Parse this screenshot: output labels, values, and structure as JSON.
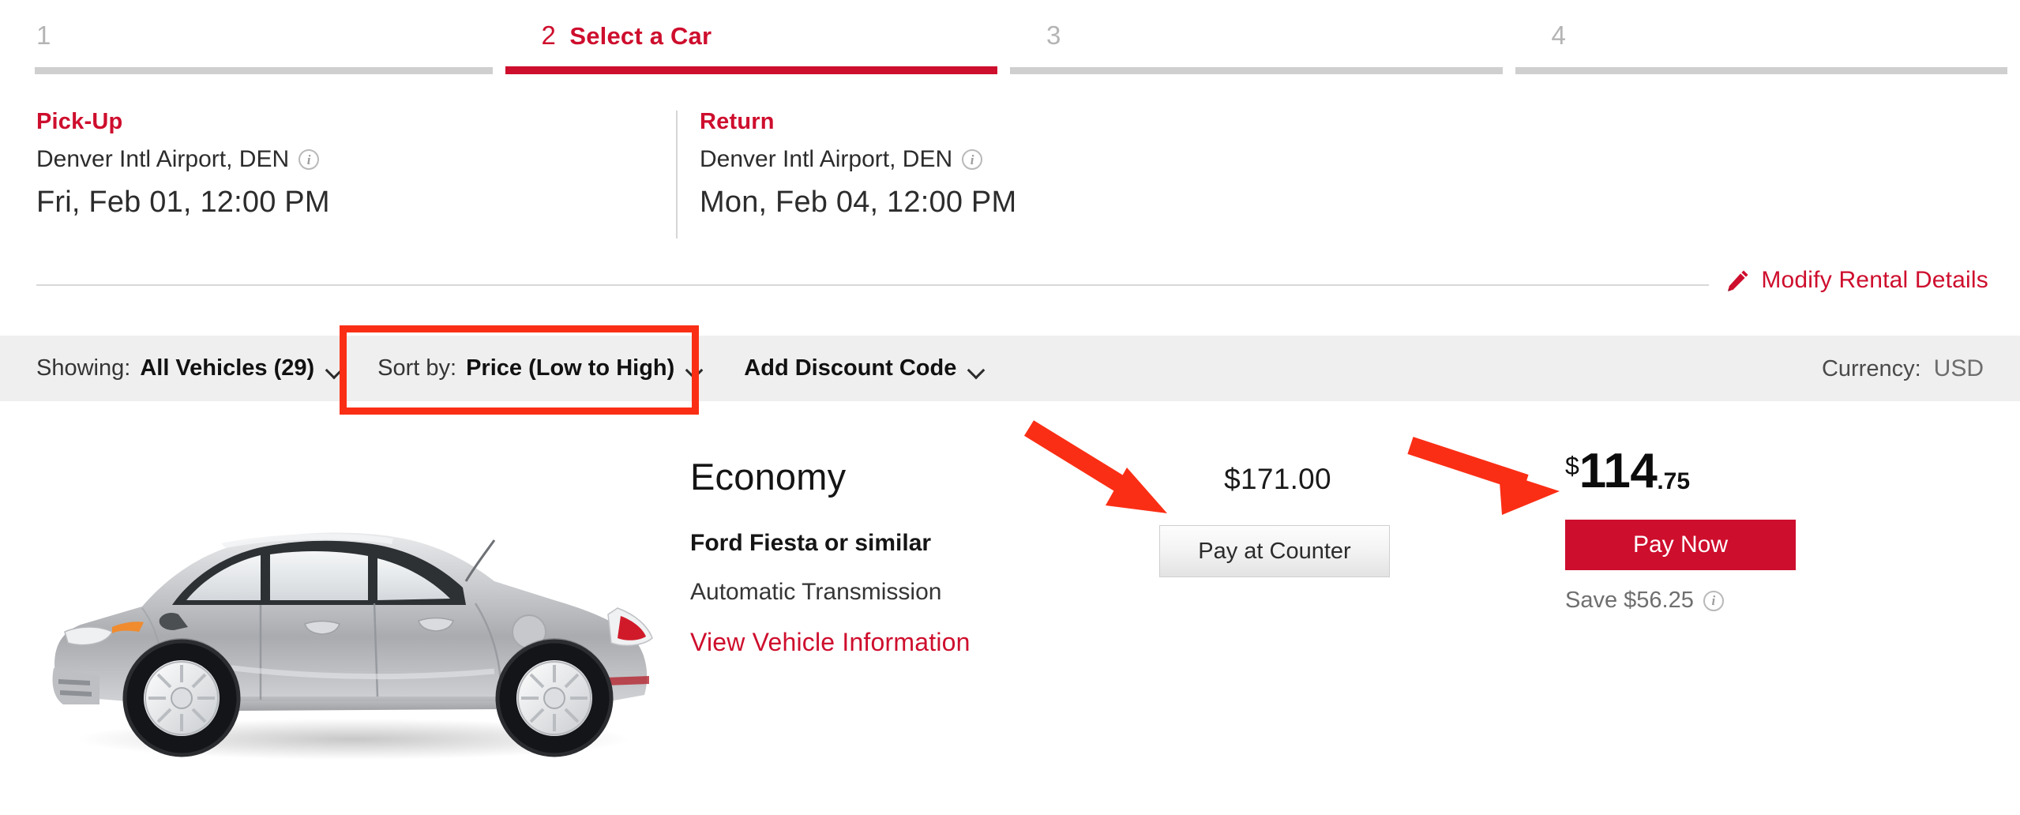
{
  "brand": {
    "red": "#CE0E2D",
    "annotation_red": "#FA2E15",
    "bar_gray": "#CFCFCF",
    "filterbar_gray": "#EFEFEF"
  },
  "steps": [
    {
      "number": "1",
      "label": "",
      "active": false
    },
    {
      "number": "2",
      "label": "Select a Car",
      "active": true
    },
    {
      "number": "3",
      "label": "",
      "active": false
    },
    {
      "number": "4",
      "label": "",
      "active": false
    }
  ],
  "summary": {
    "pickup": {
      "title": "Pick-Up",
      "location": "Denver Intl Airport, DEN",
      "datetime": "Fri, Feb 01, 12:00 PM",
      "info_icon": "info-icon"
    },
    "ret": {
      "title": "Return",
      "location": "Denver Intl Airport, DEN",
      "datetime": "Mon, Feb 04, 12:00 PM",
      "info_icon": "info-icon"
    },
    "modify_link": "Modify Rental Details",
    "modify_icon": "pencil-icon"
  },
  "filterbar": {
    "showing_label": "Showing:",
    "showing_value": "All Vehicles (29)",
    "sort_label": "Sort by:",
    "sort_value": "Price (Low to High)",
    "discount_label": "Add Discount Code",
    "currency_label": "Currency:",
    "currency_value": "USD",
    "caret_icon": "chevron-down-icon"
  },
  "vehicle": {
    "class": "Economy",
    "model": "Ford Fiesta or similar",
    "transmission": "Automatic Transmission",
    "info_link": "View Vehicle Information",
    "image_alt": "silver-sedan-car",
    "pay_at_counter": {
      "amount": "$171.00",
      "button": "Pay at Counter"
    },
    "pay_now": {
      "currency_symbol": "$",
      "dollars": "114",
      "cents": ".75",
      "button": "Pay Now",
      "save_text": "Save $56.25",
      "save_info_icon": "info-icon"
    }
  },
  "annotations": {
    "highlight_rect_target": "sort-by-dropdown",
    "arrow_1_target": "pay-at-counter-price",
    "arrow_2_target": "pay-now-price"
  }
}
